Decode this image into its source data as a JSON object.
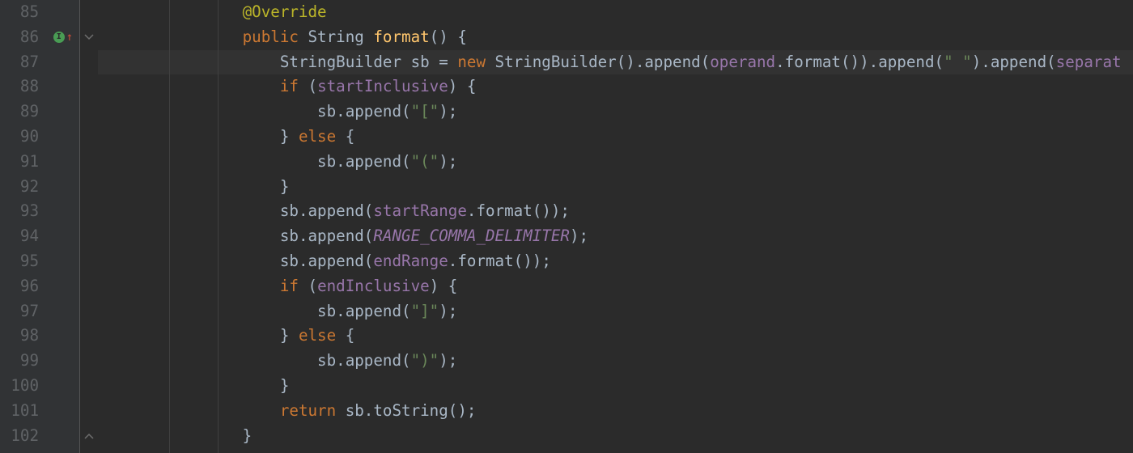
{
  "lineNumbers": [
    "85",
    "86",
    "87",
    "88",
    "89",
    "90",
    "91",
    "92",
    "93",
    "94",
    "95",
    "96",
    "97",
    "98",
    "99",
    "100",
    "101",
    "102"
  ],
  "markerRow": 1,
  "foldOpenRow": 1,
  "foldCloseRow": 17,
  "indentGuideCols": [
    88,
    148
  ],
  "lines": [
    [
      {
        "t": "            ",
        "c": "pn"
      },
      {
        "t": "@Override",
        "c": "ann"
      }
    ],
    [
      {
        "t": "            ",
        "c": "pn"
      },
      {
        "t": "public",
        "c": "kw"
      },
      {
        "t": " String ",
        "c": "type"
      },
      {
        "t": "format",
        "c": "mname"
      },
      {
        "t": "() {",
        "c": "pn"
      }
    ],
    [
      {
        "t": "                ",
        "c": "pn"
      },
      {
        "t": "StringBuilder sb = ",
        "c": "pn"
      },
      {
        "t": "new",
        "c": "kw"
      },
      {
        "t": " StringBuilder().append(",
        "c": "pn"
      },
      {
        "t": "operand",
        "c": "fld"
      },
      {
        "t": ".format()).append(",
        "c": "pn"
      },
      {
        "t": "\" \"",
        "c": "str"
      },
      {
        "t": ").append(",
        "c": "pn"
      },
      {
        "t": "separat",
        "c": "fld"
      }
    ],
    [
      {
        "t": "                ",
        "c": "pn"
      },
      {
        "t": "if",
        "c": "kw"
      },
      {
        "t": " (",
        "c": "pn"
      },
      {
        "t": "startInclusive",
        "c": "fld"
      },
      {
        "t": ") {",
        "c": "pn"
      }
    ],
    [
      {
        "t": "                    ",
        "c": "pn"
      },
      {
        "t": "sb.append(",
        "c": "pn"
      },
      {
        "t": "\"[\"",
        "c": "str"
      },
      {
        "t": ");",
        "c": "pn"
      }
    ],
    [
      {
        "t": "                ",
        "c": "pn"
      },
      {
        "t": "} ",
        "c": "pn"
      },
      {
        "t": "else",
        "c": "kw"
      },
      {
        "t": " {",
        "c": "pn"
      }
    ],
    [
      {
        "t": "                    ",
        "c": "pn"
      },
      {
        "t": "sb.append(",
        "c": "pn"
      },
      {
        "t": "\"(\"",
        "c": "str"
      },
      {
        "t": ");",
        "c": "pn"
      }
    ],
    [
      {
        "t": "                ",
        "c": "pn"
      },
      {
        "t": "}",
        "c": "pn"
      }
    ],
    [
      {
        "t": "                ",
        "c": "pn"
      },
      {
        "t": "sb.append(",
        "c": "pn"
      },
      {
        "t": "startRange",
        "c": "fld"
      },
      {
        "t": ".format());",
        "c": "pn"
      }
    ],
    [
      {
        "t": "                ",
        "c": "pn"
      },
      {
        "t": "sb.append(",
        "c": "pn"
      },
      {
        "t": "RANGE_COMMA_DELIMITER",
        "c": "const"
      },
      {
        "t": ");",
        "c": "pn"
      }
    ],
    [
      {
        "t": "                ",
        "c": "pn"
      },
      {
        "t": "sb.append(",
        "c": "pn"
      },
      {
        "t": "endRange",
        "c": "fld"
      },
      {
        "t": ".format());",
        "c": "pn"
      }
    ],
    [
      {
        "t": "                ",
        "c": "pn"
      },
      {
        "t": "if",
        "c": "kw"
      },
      {
        "t": " (",
        "c": "pn"
      },
      {
        "t": "endInclusive",
        "c": "fld"
      },
      {
        "t": ") {",
        "c": "pn"
      }
    ],
    [
      {
        "t": "                    ",
        "c": "pn"
      },
      {
        "t": "sb.append(",
        "c": "pn"
      },
      {
        "t": "\"]\"",
        "c": "str"
      },
      {
        "t": ");",
        "c": "pn"
      }
    ],
    [
      {
        "t": "                ",
        "c": "pn"
      },
      {
        "t": "} ",
        "c": "pn"
      },
      {
        "t": "else",
        "c": "kw"
      },
      {
        "t": " {",
        "c": "pn"
      }
    ],
    [
      {
        "t": "                    ",
        "c": "pn"
      },
      {
        "t": "sb.append(",
        "c": "pn"
      },
      {
        "t": "\")\"",
        "c": "str"
      },
      {
        "t": ");",
        "c": "pn"
      }
    ],
    [
      {
        "t": "                ",
        "c": "pn"
      },
      {
        "t": "}",
        "c": "pn"
      }
    ],
    [
      {
        "t": "                ",
        "c": "pn"
      },
      {
        "t": "return",
        "c": "kw"
      },
      {
        "t": " sb.toString();",
        "c": "pn"
      }
    ],
    [
      {
        "t": "            ",
        "c": "pn"
      },
      {
        "t": "}",
        "c": "pn"
      }
    ]
  ],
  "currentLine": 2
}
